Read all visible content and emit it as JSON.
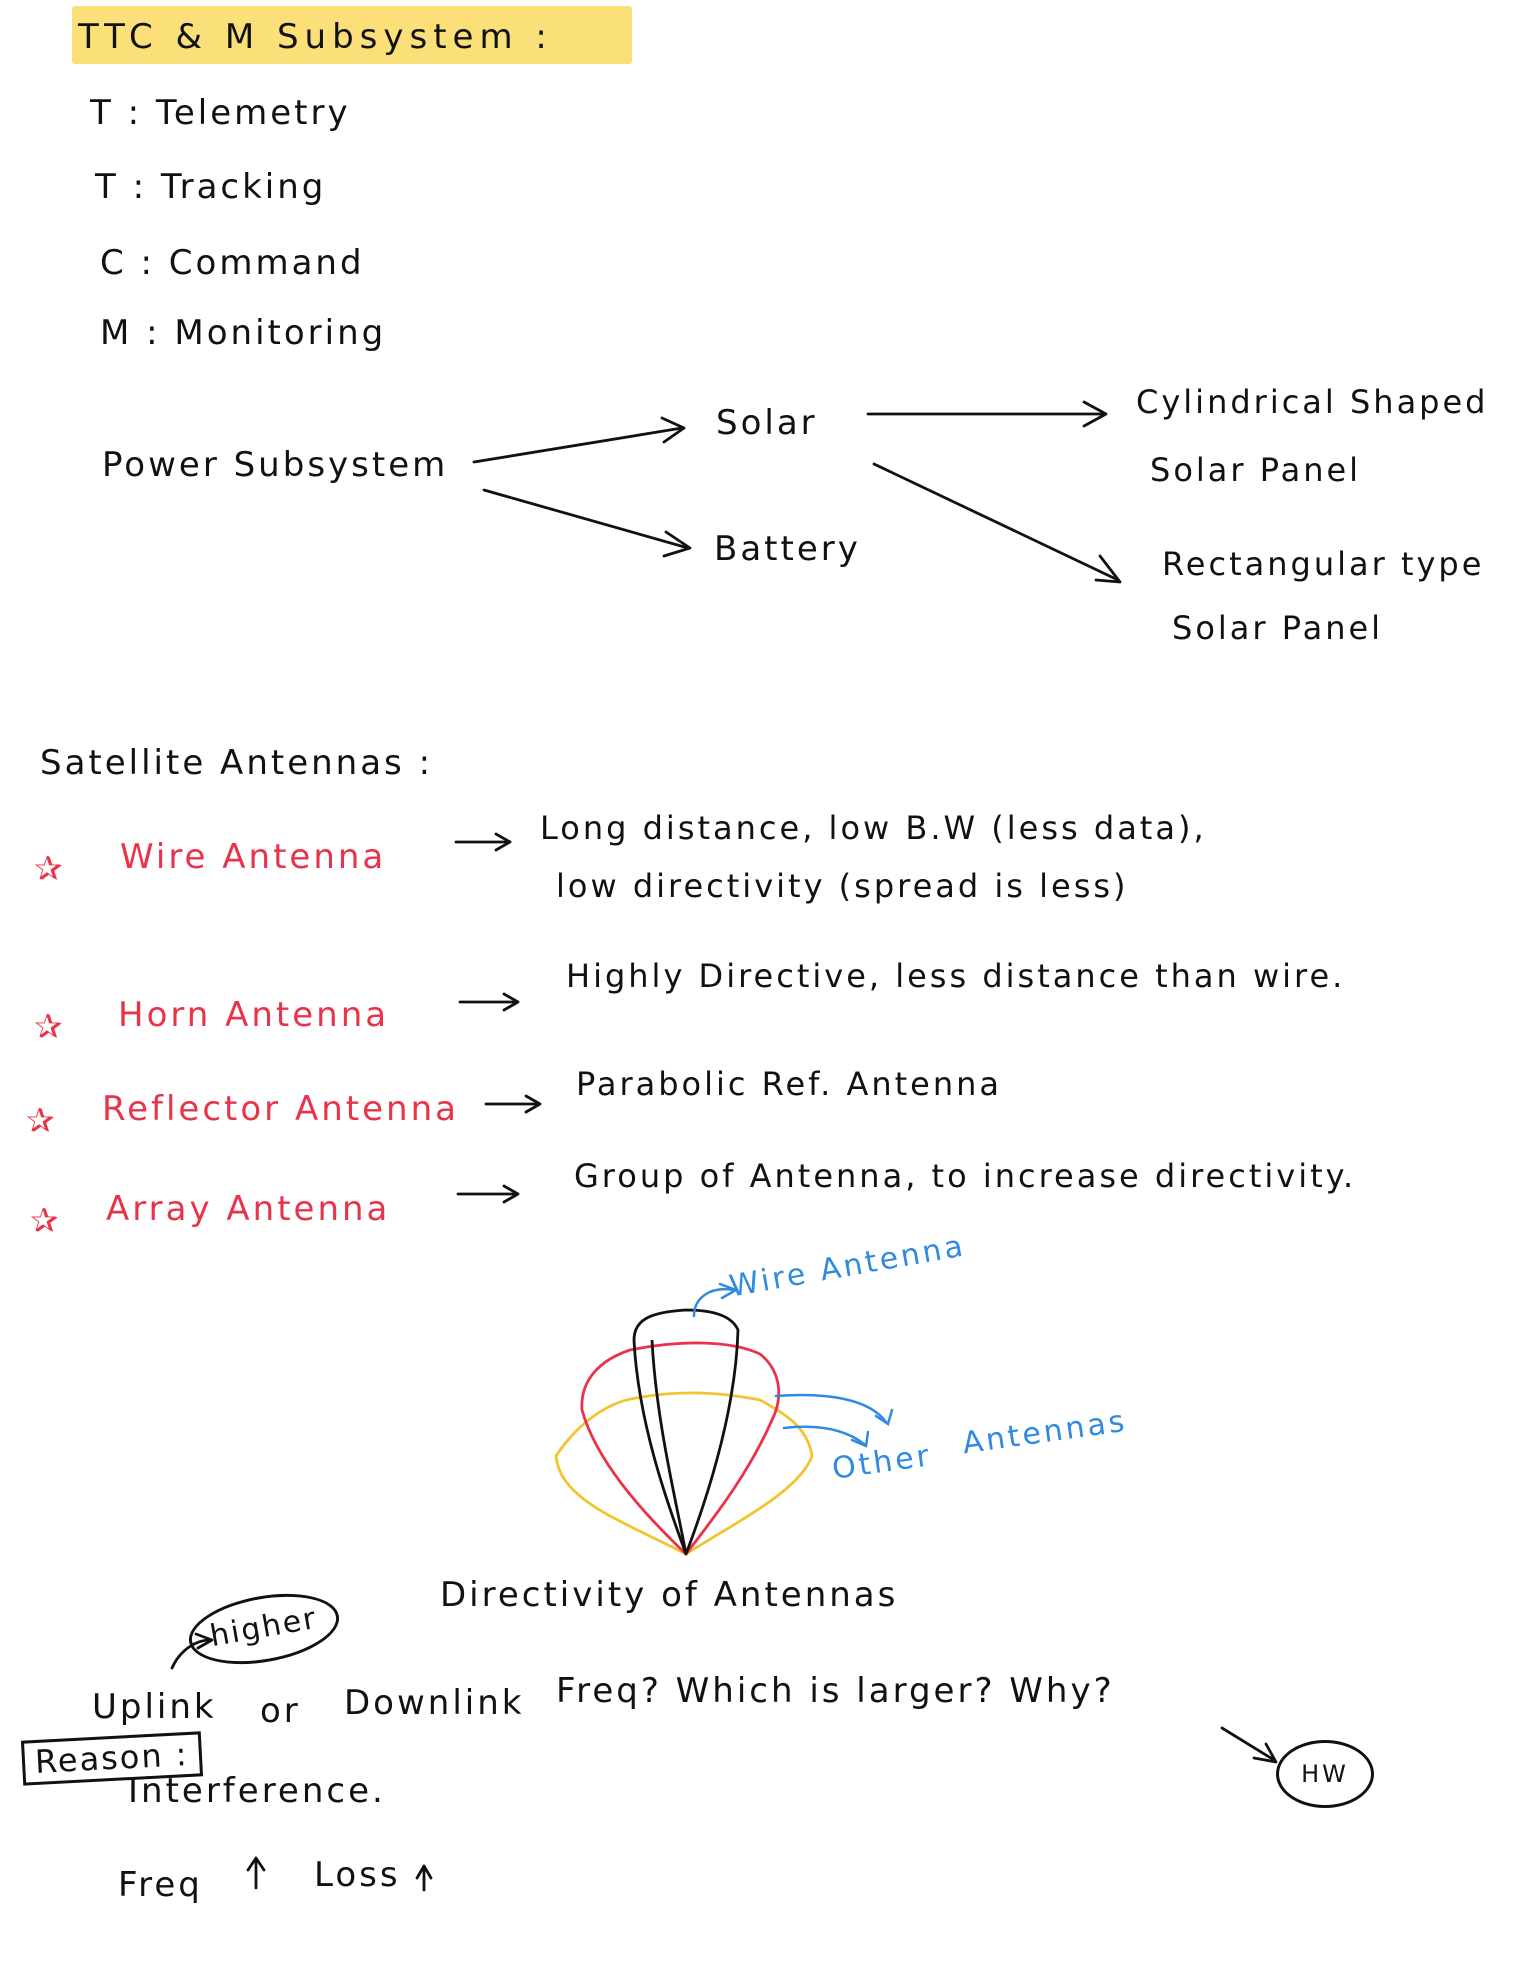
{
  "ttc": {
    "heading": "TTC & M Subsystem :",
    "items": [
      "T : Telemetry",
      "T : Tracking",
      "C : Command",
      "M : Monitoring"
    ]
  },
  "power": {
    "root": "Power Subsystem",
    "solar": "Solar",
    "battery": "Battery",
    "cyl_line1": "Cylindrical Shaped",
    "cyl_line2": "Solar Panel",
    "rect_line1": "Rectangular type",
    "rect_line2": "Solar Panel"
  },
  "antennas": {
    "heading": "Satellite Antennas :",
    "wire_name": "Wire Antenna",
    "wire_desc1": "Long distance, low B.W (less data),",
    "wire_desc2": "low directivity (spread is less)",
    "horn_name": "Horn Antenna",
    "horn_desc": "Highly Directive, less distance than wire.",
    "reflector_name": "Reflector Antenna",
    "reflector_desc": "Parabolic Ref. Antenna",
    "array_name": "Array Antenna",
    "array_desc": "Group of Antenna, to increase directivity."
  },
  "diagram": {
    "wire_label": "Wire Antenna",
    "other_label1": "Other",
    "other_label2": "Antennas",
    "caption": "Directivity of Antennas",
    "colors": {
      "wire": "#111111",
      "red": "#e8344a",
      "yellow": "#f2c530",
      "blue": "#2f8ae0"
    }
  },
  "freq": {
    "higher": "higher",
    "question_uplink": "Uplink",
    "question_or": "or",
    "question_downlink": "Downlink",
    "question_rest": "Freq? Which is larger? Why?",
    "hw": "HW",
    "reason_label": "Reason :",
    "reason": "Interference.",
    "freq_loss_a": "Freq",
    "freq_loss_b": "Loss"
  },
  "icons": {
    "star": "star-icon",
    "arrow": "arrow-right-icon",
    "up": "arrow-up-icon"
  }
}
